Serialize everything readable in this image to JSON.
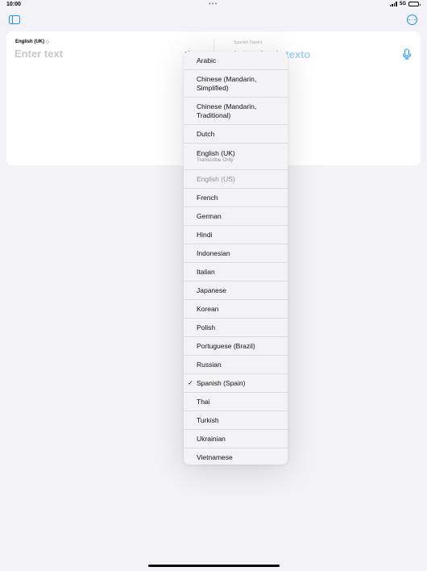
{
  "status_bar": {
    "time": "10:00",
    "dots": "•••",
    "network": "5G"
  },
  "card": {
    "source_language": "English (UK)",
    "source_placeholder": "Enter text",
    "target_language": "Spanish (Spain)",
    "target_placeholder": "Introducir texto"
  },
  "menu": {
    "items": [
      {
        "label": "Arabic",
        "sub": "",
        "checked": false,
        "disabled": false
      },
      {
        "label": "Chinese (Mandarin, Simplified)",
        "sub": "",
        "checked": false,
        "disabled": false
      },
      {
        "label": "Chinese (Mandarin, Traditional)",
        "sub": "",
        "checked": false,
        "disabled": false
      },
      {
        "label": "Dutch",
        "sub": "",
        "checked": false,
        "disabled": false
      },
      {
        "label": "English (UK)",
        "sub": "Transcribe Only",
        "checked": false,
        "disabled": false
      },
      {
        "label": "English (US)",
        "sub": "",
        "checked": false,
        "disabled": true
      },
      {
        "label": "French",
        "sub": "",
        "checked": false,
        "disabled": false
      },
      {
        "label": "German",
        "sub": "",
        "checked": false,
        "disabled": false
      },
      {
        "label": "Hindi",
        "sub": "",
        "checked": false,
        "disabled": false
      },
      {
        "label": "Indonesian",
        "sub": "",
        "checked": false,
        "disabled": false
      },
      {
        "label": "Italian",
        "sub": "",
        "checked": false,
        "disabled": false
      },
      {
        "label": "Japanese",
        "sub": "",
        "checked": false,
        "disabled": false
      },
      {
        "label": "Korean",
        "sub": "",
        "checked": false,
        "disabled": false
      },
      {
        "label": "Polish",
        "sub": "",
        "checked": false,
        "disabled": false
      },
      {
        "label": "Portuguese (Brazil)",
        "sub": "",
        "checked": false,
        "disabled": false
      },
      {
        "label": "Russian",
        "sub": "",
        "checked": false,
        "disabled": false
      },
      {
        "label": "Spanish (Spain)",
        "sub": "",
        "checked": true,
        "disabled": false
      },
      {
        "label": "Thai",
        "sub": "",
        "checked": false,
        "disabled": false
      },
      {
        "label": "Turkish",
        "sub": "",
        "checked": false,
        "disabled": false
      },
      {
        "label": "Ukrainian",
        "sub": "",
        "checked": false,
        "disabled": false
      },
      {
        "label": "Vietnamese",
        "sub": "",
        "checked": false,
        "disabled": false
      }
    ]
  },
  "colors": {
    "accent": "#1e90ff",
    "background": "#f2f2f7",
    "menu_background": "#f3f3f5"
  }
}
